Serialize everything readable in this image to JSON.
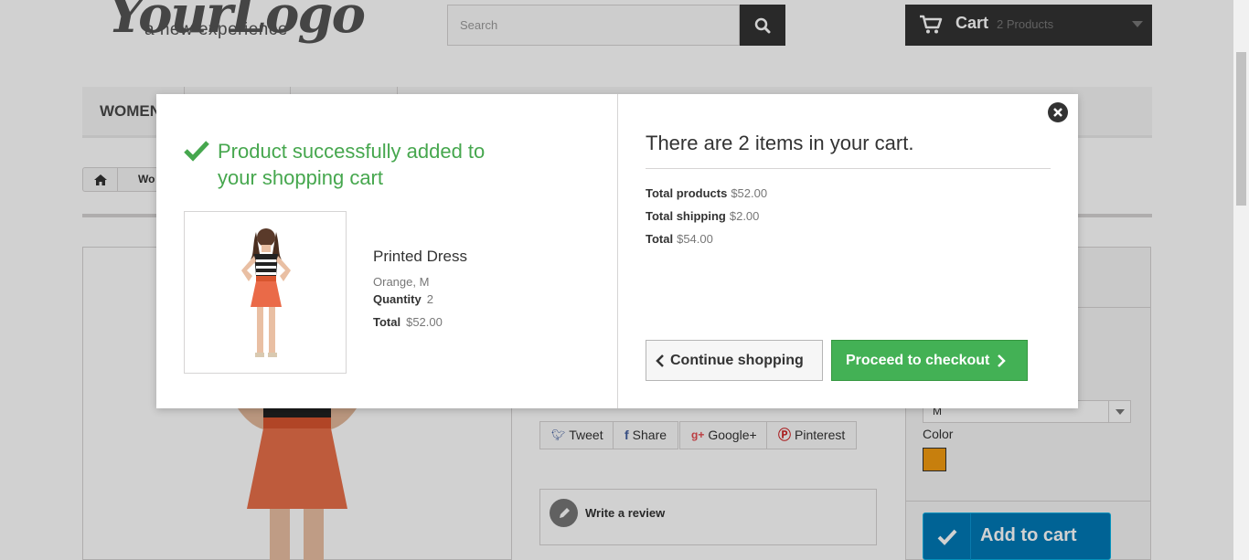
{
  "header": {
    "logo": {
      "script": "YourLogo",
      "tagline": "a new experience"
    },
    "search": {
      "placeholder": "Search",
      "value": ""
    },
    "cart": {
      "label": "Cart",
      "count_text": "2 Products"
    }
  },
  "menu": {
    "items": [
      "WOMEN"
    ]
  },
  "breadcrumb": {
    "items": [
      "Wo"
    ]
  },
  "product_page": {
    "size_value": "M",
    "color_label": "Color",
    "color_swatch": "#f39c11",
    "add_to_cart_label": "Add to cart",
    "social": [
      {
        "label": "Tweet",
        "icon": "twitter-icon"
      },
      {
        "label": "Share",
        "icon": "facebook-icon"
      },
      {
        "label": "Google+",
        "icon": "google-plus-icon"
      },
      {
        "label": "Pinterest",
        "icon": "pinterest-icon"
      }
    ],
    "write_review_label": "Write a review"
  },
  "modal": {
    "success_message": "Product successfully added to your shopping cart",
    "product": {
      "name": "Printed Dress",
      "attributes": "Orange, M",
      "quantity_label": "Quantity",
      "quantity_value": "2",
      "total_label": "Total",
      "total_value": "$52.00"
    },
    "summary": {
      "title": "There are 2 items in your cart.",
      "total_products_label": "Total products",
      "total_products_value": "$52.00",
      "total_shipping_label": "Total shipping",
      "total_shipping_value": "$2.00",
      "total_label": "Total",
      "total_value": "$54.00"
    },
    "continue_label": "Continue shopping",
    "checkout_label": "Proceed to checkout"
  },
  "colors": {
    "success_green": "#46a74e",
    "checkout_green": "#43b155",
    "add_to_cart_blue": "#0079b6",
    "dark": "#333333"
  }
}
